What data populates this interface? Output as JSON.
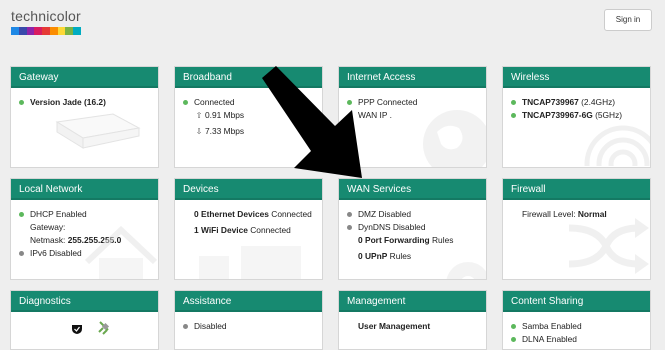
{
  "brand": {
    "name": "technicolor",
    "stripe_colors": [
      "#1e88e5",
      "#3949ab",
      "#8e24aa",
      "#d81b60",
      "#e53935",
      "#fb8c00",
      "#fdd835",
      "#7cb342",
      "#00acc1"
    ]
  },
  "header": {
    "signin_label": "Sign in"
  },
  "cards": {
    "gateway": {
      "title": "Gateway",
      "version": "Version Jade (16.2)"
    },
    "broadband": {
      "title": "Broadband",
      "status": "Connected",
      "upload": "0.91 Mbps",
      "download": "7.33 Mbps"
    },
    "internet": {
      "title": "Internet Access",
      "status": "PPP Connected",
      "wan_ip": "WAN IP ."
    },
    "wireless": {
      "title": "Wireless",
      "ssid1": "TNCAP739967",
      "band1": "(2.4GHz)",
      "ssid2": "TNCAP739967-6G",
      "band2": "(5GHz)"
    },
    "local": {
      "title": "Local Network",
      "dhcp": "DHCP Enabled",
      "gateway": "Gateway:",
      "netmask_label": "Netmask:",
      "netmask": "255.255.255.0",
      "ipv6": "IPv6 Disabled"
    },
    "devices": {
      "title": "Devices",
      "eth_count": "0 Ethernet Devices",
      "eth_suffix": "Connected",
      "wifi_count": "1 WiFi Device",
      "wifi_suffix": "Connected"
    },
    "wan": {
      "title": "WAN Services",
      "dmz": "DMZ Disabled",
      "dyndns": "DynDNS Disabled",
      "pf_count": "0 Port Forwarding",
      "pf_suffix": "Rules",
      "upnp_count": "0 UPnP",
      "upnp_suffix": "Rules"
    },
    "firewall": {
      "title": "Firewall",
      "level_label": "Firewall Level:",
      "level": "Normal"
    },
    "diagnostics": {
      "title": "Diagnostics"
    },
    "assistance": {
      "title": "Assistance",
      "status": "Disabled"
    },
    "management": {
      "title": "Management",
      "item": "User Management"
    },
    "content": {
      "title": "Content Sharing",
      "samba": "Samba Enabled",
      "dlna": "DLNA Enabled"
    }
  },
  "colors": {
    "header_green": "#178a71",
    "status_on": "#5cb85c",
    "status_off": "#888888"
  }
}
